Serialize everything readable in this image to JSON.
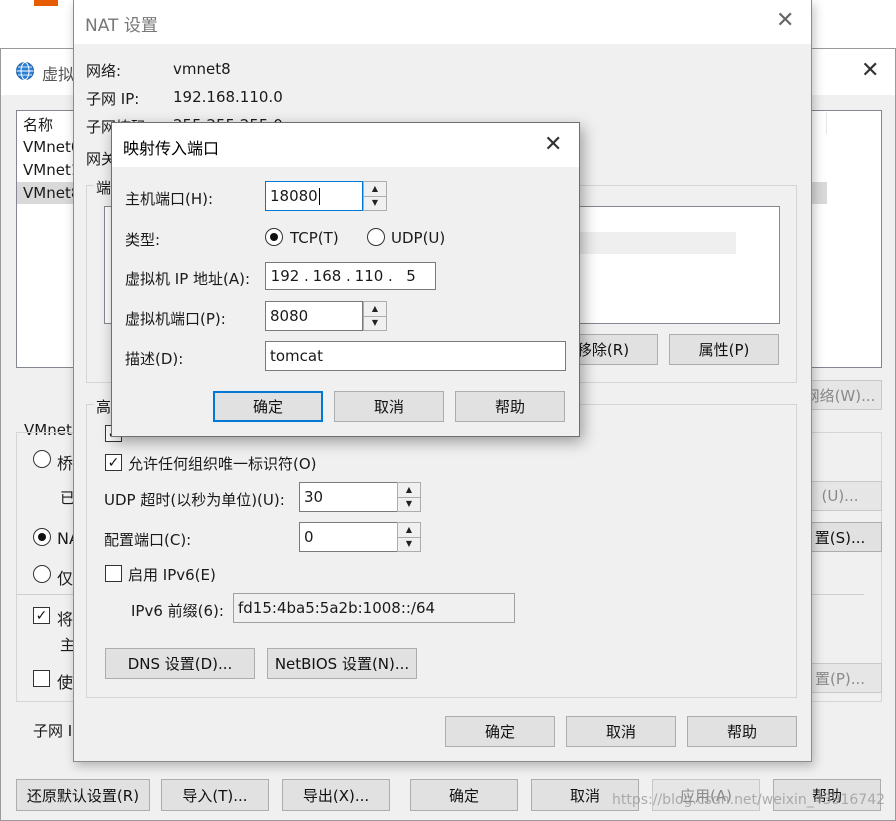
{
  "back_window": {
    "title": "虚拟",
    "list_header": "名称",
    "list_items": [
      "VMnet0",
      "VMnet1",
      "VMnet8"
    ],
    "vmnet_label": "VMnet",
    "radio_bridge": "桥",
    "bridged_to": "已",
    "radio_nat": "NA",
    "radio_host": "仅",
    "chk_connect": "将",
    "host_label": "主",
    "chk_dhcp": "使",
    "subnet_label": "子网 I",
    "btn_network": "网络(W)...",
    "btn_auto": "(U)...",
    "btn_nat": "置(S)...",
    "btn_dhcp": "置(P)...",
    "btn_remove": "移除(R)",
    "btn_props": "属性(P)",
    "btn_restore": "还原默认设置(R)",
    "btn_import": "导入(T)...",
    "btn_export": "导出(X)...",
    "btn_ok": "确定",
    "btn_cancel": "取消",
    "btn_apply": "应用(A)",
    "btn_help": "帮助",
    "watermark": "https://blog.csdn.net/weixin_43916742"
  },
  "nat_dialog": {
    "title": "NAT 设置",
    "network_label": "网络:",
    "network_value": "vmnet8",
    "subnet_ip_label": "子网 IP:",
    "subnet_ip_value": "192.168.110.0",
    "subnet_mask_label": "子网掩码:",
    "subnet_mask_value": "255.255.255.0",
    "gateway_label": "网关",
    "port_group_label": "端",
    "advanced_label": "高",
    "chk_any_oui_label": "允许任何组织唯一标识符(O)",
    "udp_timeout_label": "UDP 超时(以秒为单位)(U):",
    "udp_timeout_value": "30",
    "config_port_label": "配置端口(C):",
    "config_port_value": "0",
    "chk_ipv6_label": "启用 IPv6(E)",
    "ipv6_prefix_label": "IPv6 前缀(6):",
    "ipv6_prefix_value": "fd15:4ba5:5a2b:1008::/64",
    "btn_dns": "DNS 设置(D)...",
    "btn_netbios": "NetBIOS 设置(N)...",
    "btn_ok": "确定",
    "btn_cancel": "取消",
    "btn_help": "帮助"
  },
  "map_dialog": {
    "title": "映射传入端口",
    "host_port_label": "主机端口(H):",
    "host_port_value": "18080",
    "type_label": "类型:",
    "tcp_label": "TCP(T)",
    "udp_label": "UDP(U)",
    "vm_ip_label": "虚拟机 IP 地址(A):",
    "vm_ip_octets": [
      "192",
      "168",
      "110",
      "5"
    ],
    "vm_port_label": "虚拟机端口(P):",
    "vm_port_value": "8080",
    "desc_label": "描述(D):",
    "desc_value": "tomcat",
    "btn_ok": "确定",
    "btn_cancel": "取消",
    "btn_help": "帮助"
  },
  "colors": {
    "accent": "#0078d7",
    "dialog_bg": "#f0f0f0",
    "button_bg": "#e1e1e1"
  },
  "icons": {
    "app": "globe-icon",
    "close": "close-icon",
    "check": "checkmark-icon"
  }
}
